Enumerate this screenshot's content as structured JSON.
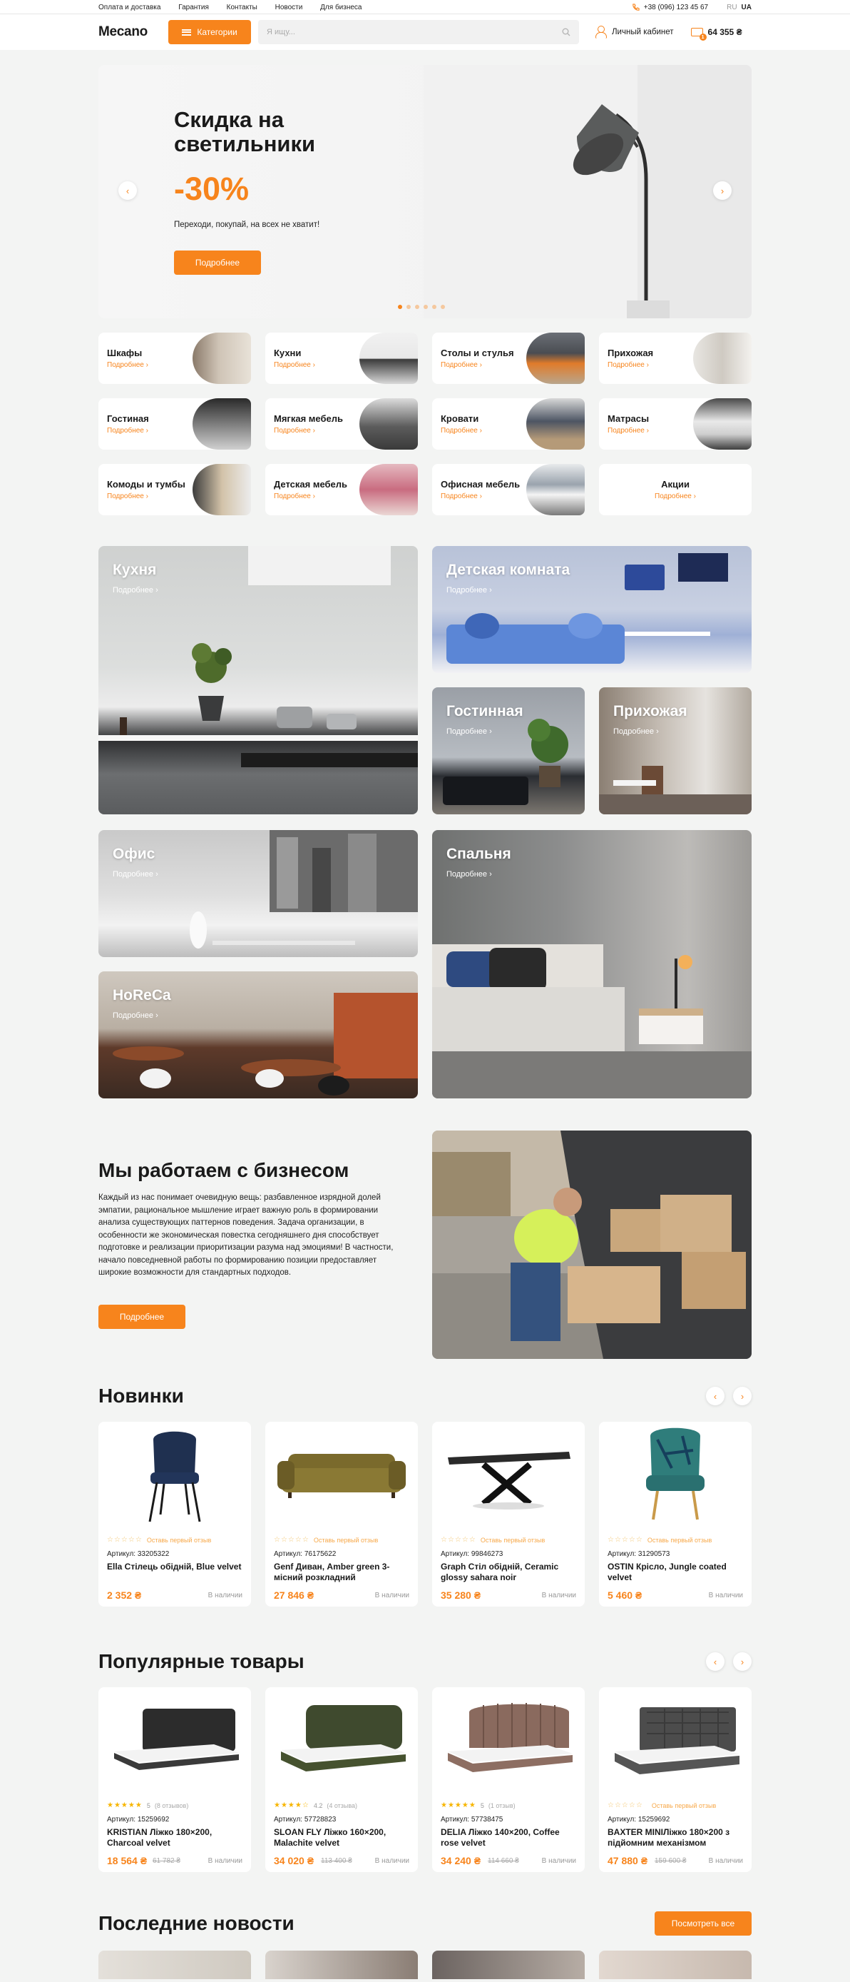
{
  "topbar": {
    "links": [
      "Оплата и доставка",
      "Гарантия",
      "Контакты",
      "Новости",
      "Для бизнеса"
    ],
    "phone": "+38 (096) 123 45 67",
    "lang_ru": "RU",
    "lang_ua": "UA"
  },
  "header": {
    "logo": "Mecano",
    "categories_label": "Категории",
    "search_placeholder": "Я ищу...",
    "cabinet_label": "Личный кабинет",
    "cart_count": "1",
    "cart_total": "64 355 ₴"
  },
  "hero": {
    "title": "Скидка на светильники",
    "discount": "-30%",
    "subtitle": "Переходи, покупай, на всех не хватит!",
    "button": "Подробнее",
    "slides": 6,
    "active_slide": 1
  },
  "more_label": "Подробнее",
  "categories": [
    {
      "title": "Шкафы",
      "more": "Подробнее"
    },
    {
      "title": "Кухни",
      "more": "Подробнее"
    },
    {
      "title": "Столы и стулья",
      "more": "Подробнее"
    },
    {
      "title": "Прихожая",
      "more": "Подробнее"
    },
    {
      "title": "Гостиная",
      "more": "Подробнее"
    },
    {
      "title": "Мягкая мебель",
      "more": "Подробнее"
    },
    {
      "title": "Кровати",
      "more": "Подробнее"
    },
    {
      "title": "Матрасы",
      "more": "Подробнее"
    },
    {
      "title": "Комоды и тумбы",
      "more": "Подробнее"
    },
    {
      "title": "Детская мебель",
      "more": "Подробнее"
    },
    {
      "title": "Офисная мебель",
      "more": "Подробнее"
    },
    {
      "title": "Акции",
      "more": "Подробнее"
    }
  ],
  "rooms": [
    {
      "title": "Кухня",
      "more": "Подробнее"
    },
    {
      "title": "Детская комната",
      "more": "Подробнее"
    },
    {
      "title": "Гостинная",
      "more": "Подробнее"
    },
    {
      "title": "Прихожая",
      "more": "Подробнее"
    },
    {
      "title": "Офис",
      "more": "Подробнее"
    },
    {
      "title": "Спальня",
      "more": "Подробнее"
    },
    {
      "title": "HoReCa",
      "more": "Подробнее"
    }
  ],
  "business": {
    "title": "Мы работаем с бизнесом",
    "text": "Каждый из нас понимает очевидную вещь: разбавленное изрядной долей эмпатии, рациональное мышление играет важную роль в формировании анализа существующих паттернов поведения. Задача организации, в особенности же экономическая повестка сегодняшнего дня способствует подготовке и реализации приоритизации разума над эмоциями! В частности, начало повседневной работы по формированию позиции предоставляет широкие возможности для стандартных подходов.",
    "button": "Подробнее"
  },
  "new_products": {
    "title": "Новинки",
    "items": [
      {
        "rating_text": "Оставь первый отзыв",
        "article": "Артикул: 33205322",
        "name": "Ella Стілець обідній, Blue velvet",
        "price": "2 352 ₴",
        "stock": "В наличии"
      },
      {
        "rating_text": "Оставь первый отзыв",
        "article": "Артикул: 76175622",
        "name": "Genf Диван, Amber green 3-місний розкладний",
        "price": "27 846 ₴",
        "stock": "В наличии"
      },
      {
        "rating_text": "Оставь первый отзыв",
        "article": "Артикул: 99846273",
        "name": "Graph Стіл обідній, Ceramic glossy sahara noir",
        "price": "35 280 ₴",
        "stock": "В наличии"
      },
      {
        "rating_text": "Оставь первый отзыв",
        "article": "Артикул: 31290573",
        "name": "OSTIN Крісло, Jungle coated velvet",
        "price": "5 460 ₴",
        "stock": "В наличии"
      }
    ]
  },
  "popular_products": {
    "title": "Популярные товары",
    "items": [
      {
        "stars": 5,
        "score": "5",
        "reviews": "(8 отзывов)",
        "article": "Артикул: 15259692",
        "name": "KRISTIAN Ліжко 180×200, Charcoal velvet",
        "price": "18 564 ₴",
        "old_price": "61 782 ₴",
        "stock": "В наличии"
      },
      {
        "stars": 4,
        "score": "4.2",
        "reviews": "(4 отзыва)",
        "article": "Артикул: 57728823",
        "name": "SLOAN FLY Ліжко 160×200, Malachite velvet",
        "price": "34 020 ₴",
        "old_price": "113 400 ₴",
        "stock": "В наличии"
      },
      {
        "stars": 5,
        "score": "5",
        "reviews": "(1 отзыв)",
        "article": "Артикул: 57738475",
        "name": "DELIA Ліжко 140×200, Coffee rose velvet",
        "price": "34 240 ₴",
        "old_price": "114 660 ₴",
        "stock": "В наличии"
      },
      {
        "stars": 0,
        "score": "",
        "reviews": "Оставь первый отзыв",
        "article": "Артикул: 15259692",
        "name": "BAXTER MINIЛіжко 180×200 з підйомним механізмом",
        "price": "47 880 ₴",
        "old_price": "159 600 ₴",
        "stock": "В наличии"
      }
    ]
  },
  "news": {
    "title": "Последние новости",
    "button": "Посмотреть все"
  },
  "colors": {
    "accent": "#f7841c",
    "background": "#f3f4f3"
  },
  "icons": [
    "search-icon",
    "user-icon",
    "cart-icon",
    "chevron-left-icon",
    "chevron-right-icon",
    "burger-icon"
  ]
}
